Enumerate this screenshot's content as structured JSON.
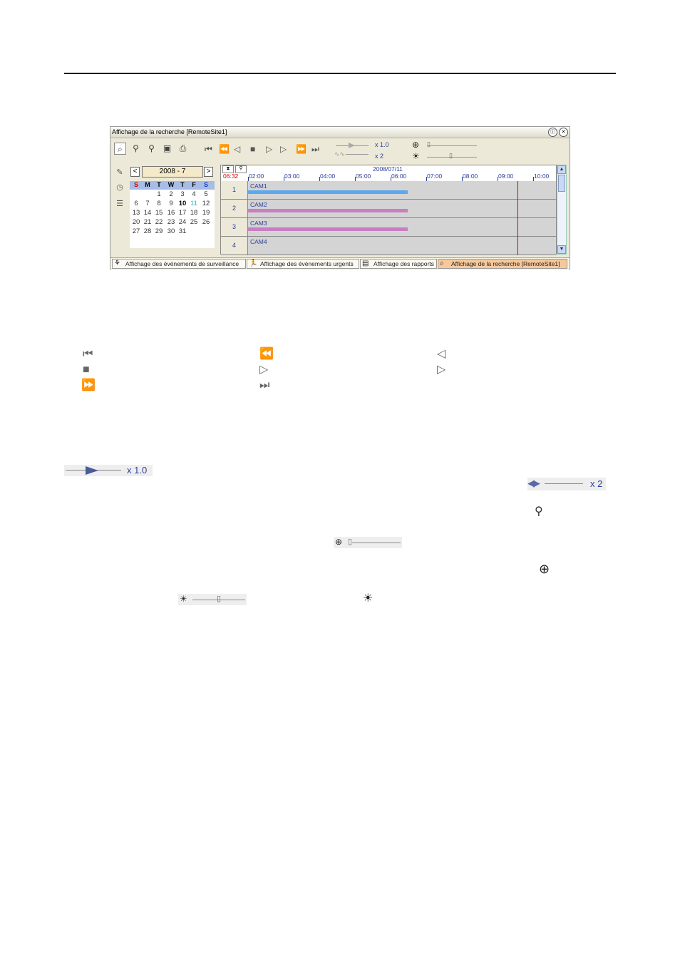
{
  "window": {
    "title": "Affichage de la recherche [RemoteSite1]",
    "title_buttons": [
      "ⓘ",
      "✕"
    ],
    "speed_label": "x 1.0",
    "audio_label": "x 2",
    "calendar": {
      "month_label": "2008 - 7",
      "prev": "<",
      "next": ">",
      "weekday_headers": [
        "S",
        "M",
        "T",
        "W",
        "T",
        "F",
        "S"
      ],
      "days": [
        [
          null,
          null,
          "1",
          "2",
          "3",
          "4",
          "5"
        ],
        [
          "6",
          "7",
          "8",
          "9",
          "10",
          "11",
          "12"
        ],
        [
          "13",
          "14",
          "15",
          "16",
          "17",
          "18",
          "19"
        ],
        [
          "20",
          "21",
          "22",
          "23",
          "24",
          "25",
          "26"
        ],
        [
          "27",
          "28",
          "29",
          "30",
          "31",
          null,
          null
        ]
      ]
    },
    "timeline": {
      "current_time": "06:32",
      "date": "2008/07/11",
      "hours": [
        "02:00",
        "03:00",
        "04:00",
        "05:00",
        "06:00",
        "07:00",
        "08:00",
        "09:00",
        "10:00"
      ],
      "rows": [
        {
          "num": "1",
          "cam": "CAM1",
          "bar_color": "#59a8f0"
        },
        {
          "num": "2",
          "cam": "CAM2",
          "bar_color": "#c77fc2"
        },
        {
          "num": "3",
          "cam": "CAM3",
          "bar_color": "#c77fc2"
        },
        {
          "num": "4",
          "cam": "CAM4",
          "bar_color": null
        }
      ]
    },
    "tabs": [
      {
        "label": "Affichage des événements de surveillance",
        "active": false
      },
      {
        "label": "Affichage des événements urgents",
        "active": false
      },
      {
        "label": "Affichage des rapports",
        "active": false
      },
      {
        "label": "Affichage de la recherche [RemoteSite1]",
        "active": true
      }
    ]
  },
  "doc": {
    "speed_label": "x 1.0",
    "audio_label": "x 2"
  }
}
